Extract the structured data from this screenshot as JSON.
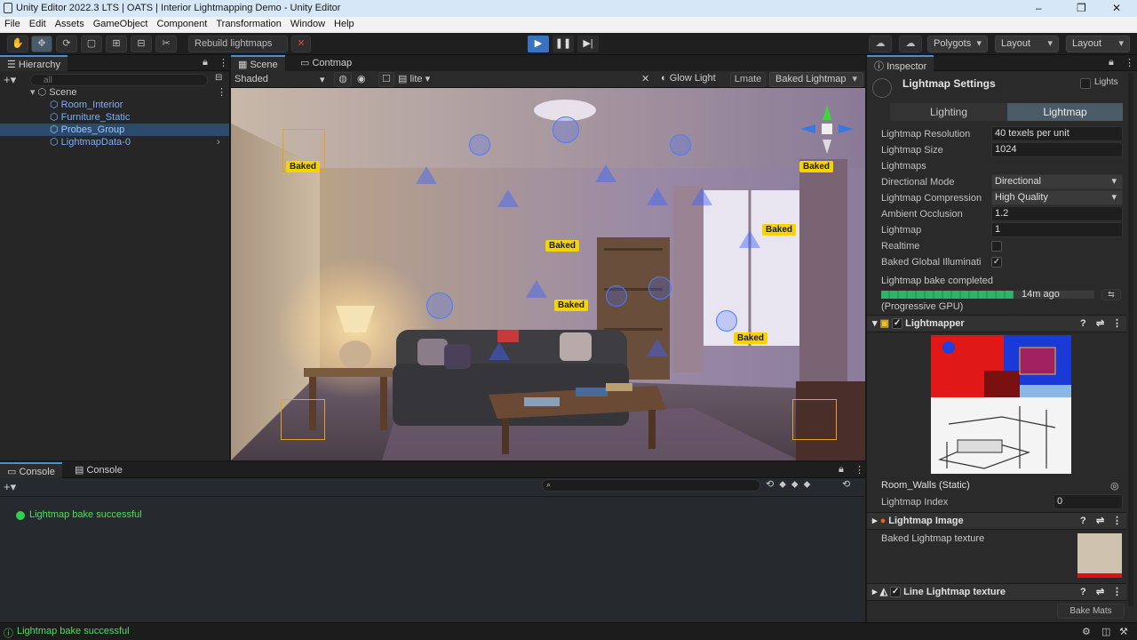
{
  "window": {
    "title": "Unity Editor 2022.3 LTS | OATS | Interior Lightmapping Demo - Unity Editor",
    "min": "–",
    "max": "❐",
    "close": "✕"
  },
  "menu": [
    "File",
    "Edit",
    "Assets",
    "GameObject",
    "Component",
    "Transformation",
    "Window",
    "Help"
  ],
  "toolbar": {
    "tools": [
      "✋",
      "✥",
      "⟳",
      "▢",
      "⊞",
      "⊟",
      "✂"
    ],
    "scene_action": "Rebuild lightmaps",
    "cancel": "✕",
    "play": "▶",
    "pause": "❚❚",
    "step": "▶|",
    "cloud": "☁",
    "collab": "☁",
    "layers": "Polygots",
    "layout1": "Layout",
    "layout2": "Layout"
  },
  "hierarchy": {
    "tab": "Hierarchy",
    "search_placeholder": "all",
    "items": [
      {
        "label": "Scene",
        "indent": 1
      },
      {
        "label": "Room_Interior",
        "indent": 2
      },
      {
        "label": "Furniture_Static",
        "indent": 2
      },
      {
        "label": "Probes_Group",
        "indent": 2,
        "selected": true
      },
      {
        "label": "LightmapData-0",
        "indent": 2
      }
    ]
  },
  "scene": {
    "tabs": [
      "Scene",
      "Contmap"
    ],
    "shading": "Shaded",
    "toolbar_right": [
      "Glow Light",
      "Lmate",
      "Baked Lightmap"
    ],
    "labels": [
      "Baked",
      "Baked",
      "Baked",
      "Baked",
      "Baked",
      "Baked"
    ]
  },
  "console": {
    "tabs": [
      "Console",
      "Console"
    ],
    "message": "Lightmap bake successful",
    "clear": "⟲"
  },
  "inspector": {
    "tab": "Inspector",
    "title": "Lightmap Settings",
    "static_label": "Lights",
    "subtabs": [
      "Lighting",
      "Lightmap"
    ],
    "rows": [
      {
        "label": "Lightmap Resolution",
        "value": "40 texels per unit",
        "type": "field"
      },
      {
        "label": "Lightmap Size",
        "value": "1024",
        "type": "field"
      },
      {
        "label": "Lightmaps",
        "value": "",
        "type": "none"
      },
      {
        "label": "Directional Mode",
        "value": "Directional",
        "type": "dropdown"
      },
      {
        "label": "Lightmap Compression",
        "value": "High Quality",
        "type": "dropdown"
      },
      {
        "label": "Ambient Occlusion",
        "value": "1.2",
        "type": "field"
      },
      {
        "label": "Lightmap",
        "value": "1",
        "type": "field"
      },
      {
        "label": "Realtime",
        "value": "",
        "type": "check_off"
      },
      {
        "label": "Baked Global Illuminati",
        "value": "✓",
        "type": "check_on"
      }
    ],
    "bake_status": "Lightmap bake completed",
    "bake_time": "14m ago",
    "bake_progress": 0.62,
    "bake_mode": "(Progressive GPU)",
    "comp1": "Lightmapper",
    "object": "Room_Walls (Static)",
    "lightmap_index_label": "Lightmap Index",
    "lightmap_index": "0",
    "comp2": "Lightmap Image",
    "baked_texture_label": "Baked Lightmap texture",
    "comp3": "Line Lightmap texture",
    "footer_button": "Bake Mats"
  },
  "statusbar": {
    "message": "Lightmap bake successful"
  }
}
